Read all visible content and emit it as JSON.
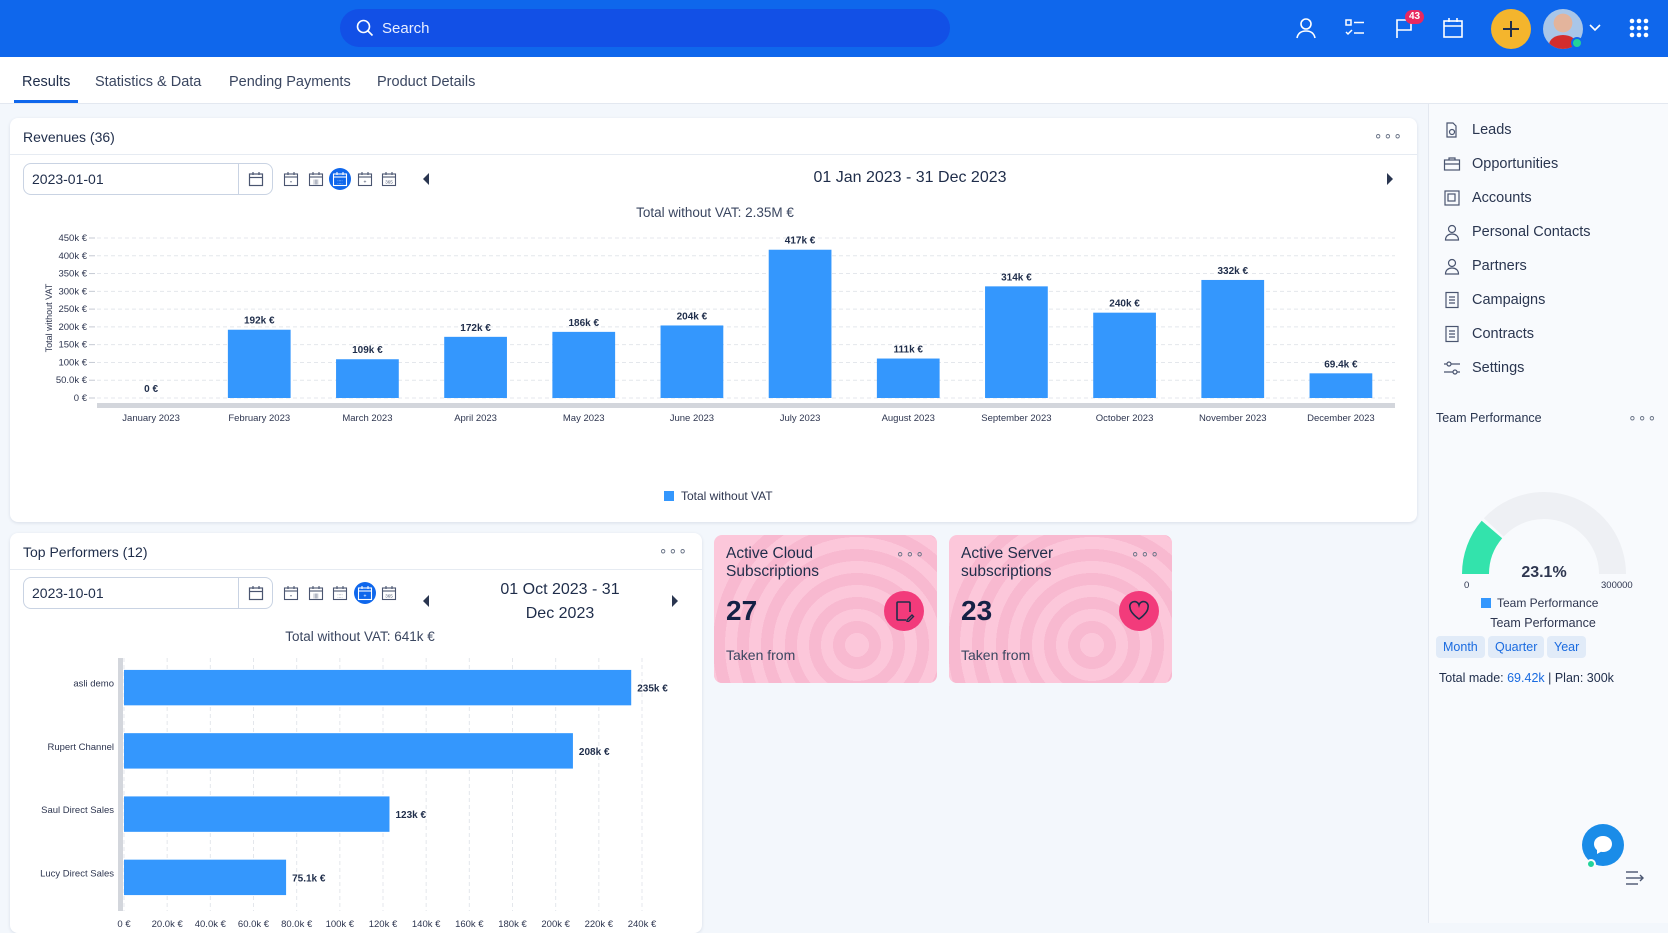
{
  "topbar": {
    "search_placeholder": "Search",
    "notifications_count": "43",
    "colors": {
      "bar": "#0f67ec",
      "plus": "#f4b52d"
    }
  },
  "tabs": [
    {
      "label": "Results",
      "active": true
    },
    {
      "label": "Statistics & Data",
      "active": false
    },
    {
      "label": "Pending Payments",
      "active": false
    },
    {
      "label": "Product Details",
      "active": false
    }
  ],
  "revenues": {
    "title": "Revenues (36)",
    "date_value": "2023-01-01",
    "range_label": "01 Jan 2023 - 31 Dec 2023",
    "total_label": "Total without VAT: 2.35M €",
    "legend_label": "Total without VAT",
    "period_icons": [
      "day",
      "week",
      "month",
      "quarter",
      "year"
    ],
    "active_period": "month"
  },
  "top_performers": {
    "title": "Top Performers (12)",
    "date_value": "2023-10-01",
    "range_line1": "01 Oct 2023 - 31",
    "range_line2": "Dec 2023",
    "total_label": "Total without VAT: 641k €",
    "period_icons": [
      "day",
      "week",
      "month",
      "quarter",
      "year"
    ],
    "active_period": "quarter"
  },
  "kpis": [
    {
      "title": "Active Cloud Subscriptions",
      "value": "27",
      "footer": "Taken from",
      "icon": "tablet-edit-icon"
    },
    {
      "title": "Active Server subscriptions",
      "value": "23",
      "footer": "Taken from",
      "icon": "heart-icon"
    }
  ],
  "sidebar": {
    "items": [
      {
        "label": "Leads",
        "icon": "leads-icon"
      },
      {
        "label": "Opportunities",
        "icon": "briefcase-icon"
      },
      {
        "label": "Accounts",
        "icon": "accounts-icon"
      },
      {
        "label": "Personal Contacts",
        "icon": "person-icon"
      },
      {
        "label": "Partners",
        "icon": "person-icon"
      },
      {
        "label": "Campaigns",
        "icon": "document-icon"
      },
      {
        "label": "Contracts",
        "icon": "document-icon"
      },
      {
        "label": "Settings",
        "icon": "sliders-icon"
      }
    ],
    "team_performance": {
      "title": "Team Performance",
      "percent_label": "23.1%",
      "percent": 23.1,
      "min_label": "0",
      "max_label": "300000",
      "legend_label": "Team Performance",
      "subtitle": "Team Performance",
      "chips": [
        "Month",
        "Quarter",
        "Year"
      ],
      "total_made_label": "Total made:",
      "total_made_value": "69.42k",
      "plan_label": "| Plan: 300k"
    }
  },
  "chart_data": [
    {
      "type": "bar",
      "title": "Total without VAT: 2.35M €",
      "xlabel": "",
      "ylabel": "Total without VAT",
      "categories": [
        "January 2023",
        "February 2023",
        "March 2023",
        "April 2023",
        "May 2023",
        "June 2023",
        "July 2023",
        "August 2023",
        "September 2023",
        "October 2023",
        "November 2023",
        "December 2023"
      ],
      "values": [
        0,
        192000,
        109000,
        172000,
        186000,
        204000,
        417000,
        111000,
        314000,
        240000,
        332000,
        69400
      ],
      "value_labels": [
        "0 €",
        "192k €",
        "109k €",
        "172k €",
        "186k €",
        "204k €",
        "417k €",
        "111k €",
        "314k €",
        "240k €",
        "332k €",
        "69.4k €"
      ],
      "y_ticks": [
        0,
        50000,
        100000,
        150000,
        200000,
        250000,
        300000,
        350000,
        400000,
        450000
      ],
      "y_tick_labels": [
        "0 €",
        "50.0k €",
        "100k €",
        "150k €",
        "200k €",
        "250k €",
        "300k €",
        "350k €",
        "400k €",
        "450k €"
      ],
      "ylim": [
        0,
        450000
      ],
      "grid": true,
      "legend": [
        "Total without VAT"
      ],
      "legend_position": "bottom",
      "color": "#3497fd"
    },
    {
      "type": "bar",
      "orientation": "horizontal",
      "title": "Total without VAT: 641k €",
      "categories": [
        "asli demo",
        "Rupert Channel",
        "Saul Direct Sales",
        "Lucy Direct Sales"
      ],
      "values": [
        235000,
        208000,
        123000,
        75100
      ],
      "value_labels": [
        "235k €",
        "208k €",
        "123k €",
        "75.1k €"
      ],
      "x_ticks": [
        0,
        20000,
        40000,
        60000,
        80000,
        100000,
        120000,
        140000,
        160000,
        180000,
        200000,
        220000,
        240000
      ],
      "x_tick_labels": [
        "0 €",
        "20.0k €",
        "40.0k €",
        "60.0k €",
        "80.0k €",
        "100k €",
        "120k €",
        "140k €",
        "160k €",
        "180k €",
        "200k €",
        "220k €",
        "240k €"
      ],
      "xlim": [
        0,
        240000
      ],
      "grid": true,
      "color": "#3497fd"
    },
    {
      "type": "gauge",
      "title": "Team Performance",
      "value": 69420,
      "min": 0,
      "max": 300000,
      "percent": 23.1,
      "color": "#33e3ac",
      "track_color": "#eef0f4"
    }
  ]
}
